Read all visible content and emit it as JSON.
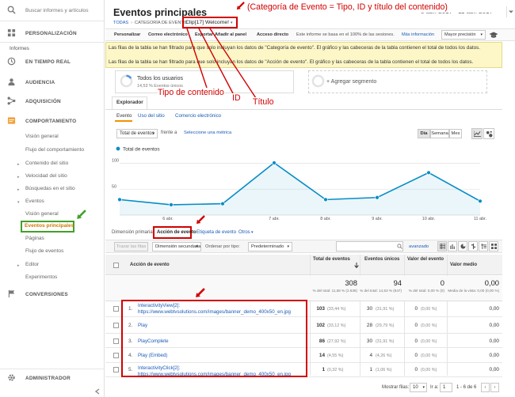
{
  "sidebar": {
    "search_placeholder": "Buscar informes y artículos",
    "personalization": "PERSONALIZACIÓN",
    "reports_header": "Informes",
    "realtime": "EN TIEMPO REAL",
    "audience": "AUDIENCIA",
    "acquisition": "ADQUISICIÓN",
    "behavior": "COMPORTAMIENTO",
    "overview": "Visión general",
    "behavior_flow": "Flujo del comportamiento",
    "site_content": "Contenido del sitio",
    "site_speed": "Velocidad del sitio",
    "site_search": "Búsquedas en el sitio",
    "events": "Eventos",
    "events_overview": "Visión general",
    "top_events": "Eventos principales",
    "pages": "Páginas",
    "events_flow": "Flujo de eventos",
    "publisher": "Editor",
    "experiments": "Experimentos",
    "conversions": "CONVERSIONES",
    "admin": "ADMINISTRADOR"
  },
  "header": {
    "title": "Eventos principales",
    "date_range": "5 abr. 2017 - 11 abr. 2017",
    "annotation_top": "(Categoría de Evento = Tipo, ID y título del contenido)",
    "bc_all": "TODAS",
    "bc_cat": "CATEGORÍA DE EVENTO:",
    "bc_seg1": "Clip",
    "bc_seg2": "[17]",
    "bc_seg3": "Welcome!"
  },
  "toolbar": {
    "personalize": "Personalizar",
    "email": "Correo electrónico",
    "export": "Exportar",
    "add_dashboard": "Añadir al panel",
    "shortcut": "Acceso directo",
    "sampling_text": "Este informe se basa en el 100% de las sesiones.",
    "more_info": "Más información",
    "precision": "Mayor precisión"
  },
  "notices": {
    "n1": "Las filas de la tabla se han filtrado para que solo incluyan los datos de \"Categoría de evento\". El gráfico y las cabeceras de la tabla contienen el total de todos los datos.",
    "n2": "Las filas de la tabla se han filtrado para que solo incluyan los datos de \"Acción de evento\". El gráfico y las cabeceras de la tabla contienen el total de todos los datos."
  },
  "segments": {
    "all_users": "Todos los usuarios",
    "all_users_sub": "14,53 % Eventos únicos",
    "add_segment": "+ Agregar segmento"
  },
  "annotations": {
    "content_type": "Tipo de contenido",
    "id": "ID",
    "title": "Título"
  },
  "explorer": {
    "tab": "Explorador",
    "sub_event": "Evento",
    "sub_site_usage": "Uso del sitio",
    "sub_ecommerce": "Comercio electrónico",
    "metric1": "Total de eventos",
    "versus": "frente a",
    "select_metric": "Seleccione una métrica",
    "day": "Día",
    "week": "Semana",
    "month": "Mes"
  },
  "chart_data": {
    "type": "line",
    "series": [
      {
        "name": "Total de eventos",
        "values": [
          30,
          20,
          22,
          101,
          30,
          34,
          82,
          27
        ]
      }
    ],
    "x": [
      "5 abr.",
      "6 abr.",
      "6 abr. b",
      "7 abr.",
      "8 abr.",
      "9 abr.",
      "10 abr.",
      "11 abr."
    ],
    "tick_labels": [
      "6 abr.",
      "7 abr.",
      "8 abr.",
      "9 abr.",
      "10 abr.",
      "11 abr."
    ],
    "y_tick_labels": [
      "100",
      "50"
    ],
    "ylim": [
      0,
      110
    ],
    "color": "#058dc7",
    "legend": "top-left",
    "grid": true
  },
  "dimensions": {
    "label": "Dimensión primaria:",
    "event_action": "Acción de evento",
    "event_label": "Etiqueta de evento",
    "others": "Otros"
  },
  "table_controls": {
    "plot_rows": "Trazar las filas",
    "secondary_dim": "Dimensión secundaria",
    "sort_type_label": "Ordenar por tipo:",
    "sort_default": "Predeterminado",
    "advanced": "avanzado"
  },
  "table": {
    "col_action": "Acción de evento",
    "col_total": "Total de eventos",
    "col_unique": "Eventos únicos",
    "col_value": "Valor del evento",
    "col_avg": "Valor medio",
    "totals": {
      "total": "308",
      "total_sub": "% del total: 11,68 % (2.636)",
      "unique": "94",
      "unique_sub": "% del total: 14,53 % (647)",
      "value": "0",
      "value_sub": "% del total: 0,00 % (0)",
      "avg": "0,00",
      "avg_sub": "Media de la vista: 0,00 (0,00 %)"
    },
    "rows": [
      {
        "n": "1.",
        "action_l1": "InteractivityView[2]:",
        "action_l2": "https://www.webtvsolutions.com/images/banner_demo_400x50_en.jpg",
        "total": "103",
        "total_pct": "(33,44 %)",
        "unique": "30",
        "unique_pct": "(31,91 %)",
        "value": "0",
        "value_pct": "(0,00 %)",
        "avg": "0,00"
      },
      {
        "n": "2.",
        "action_l1": "Play",
        "action_l2": "",
        "total": "102",
        "total_pct": "(33,12 %)",
        "unique": "28",
        "unique_pct": "(29,79 %)",
        "value": "0",
        "value_pct": "(0,00 %)",
        "avg": "0,00"
      },
      {
        "n": "3.",
        "action_l1": "PlayComplete",
        "action_l2": "",
        "total": "86",
        "total_pct": "(27,92 %)",
        "unique": "30",
        "unique_pct": "(31,91 %)",
        "value": "0",
        "value_pct": "(0,00 %)",
        "avg": "0,00"
      },
      {
        "n": "4.",
        "action_l1": "Play (Embed)",
        "action_l2": "",
        "total": "14",
        "total_pct": "(4,55 %)",
        "unique": "4",
        "unique_pct": "(4,26 %)",
        "value": "0",
        "value_pct": "(0,00 %)",
        "avg": "0,00"
      },
      {
        "n": "5.",
        "action_l1": "InteractivityClick[2]:",
        "action_l2": "https://www.webtvsolutions.com/images/banner_demo_400x50_en.jpg",
        "total": "1",
        "total_pct": "(0,32 %)",
        "unique": "1",
        "unique_pct": "(1,06 %)",
        "value": "0",
        "value_pct": "(0,00 %)",
        "avg": "0,00"
      }
    ]
  },
  "pagination": {
    "show_rows": "Mostrar filas:",
    "rows_value": "10",
    "goto": "Ir a:",
    "goto_value": "1",
    "range": "1 - 6 de 6"
  }
}
